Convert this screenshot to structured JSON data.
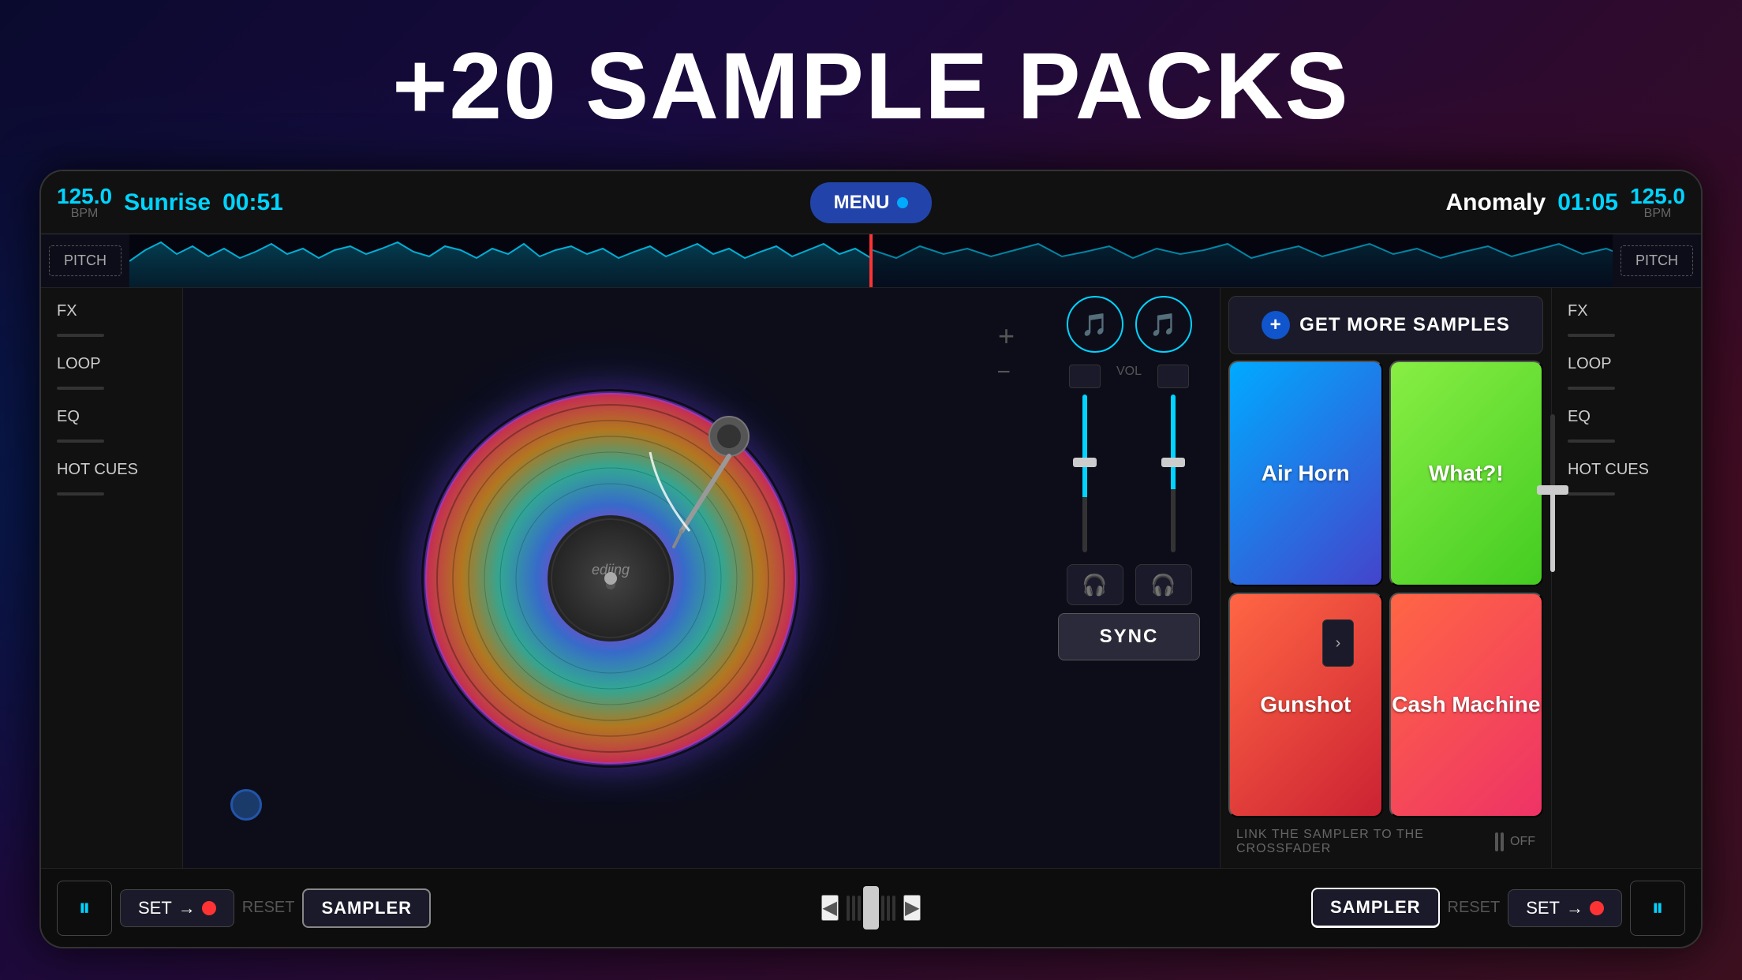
{
  "page": {
    "title": "+20 SAMPLE PACKS"
  },
  "header": {
    "left_bpm": "125.0",
    "left_bpm_label": "BPM",
    "left_track": "Sunrise",
    "left_time": "00:51",
    "menu_label": "MENU",
    "right_track": "Anomaly",
    "right_time": "01:05",
    "right_bpm": "125.0",
    "right_bpm_label": "BPM",
    "pitch_label": "PITCH"
  },
  "left_panel": {
    "fx_label": "FX",
    "loop_label": "LOOP",
    "eq_label": "EQ",
    "hot_cues_label": "HOT CUES"
  },
  "right_panel": {
    "fx_label": "FX",
    "loop_label": "LOOP",
    "eq_label": "EQ",
    "hot_cues_label": "HOT CUES"
  },
  "sampler": {
    "get_more_label": "GET MORE SAMPLES",
    "nav_arrow": "›",
    "pads": [
      {
        "id": "air-horn",
        "label": "Air Horn",
        "color_class": "sample-pad-air-horn"
      },
      {
        "id": "what",
        "label": "What?!",
        "color_class": "sample-pad-what"
      },
      {
        "id": "gunshot",
        "label": "Gunshot",
        "color_class": "sample-pad-gunshot"
      },
      {
        "id": "cash-machine",
        "label": "Cash Machine",
        "color_class": "sample-pad-cash"
      }
    ],
    "crossfader_text": "LINK THE SAMPLER TO THE CROSSFADER",
    "off_label": "OFF"
  },
  "mixer": {
    "vol_label": "VOL",
    "sync_label": "SYNC"
  },
  "transport": {
    "left_pause": "⏸",
    "left_set": "SET",
    "left_arrow": "→",
    "left_reset": "RESET",
    "left_sampler": "SAMPLER",
    "cf_arrow_left": "◀",
    "cf_arrow_right": "▶",
    "right_sampler": "SAMPLER",
    "right_reset": "RESET",
    "right_set": "SET",
    "right_arrow": "→",
    "right_pause": "⏸"
  }
}
